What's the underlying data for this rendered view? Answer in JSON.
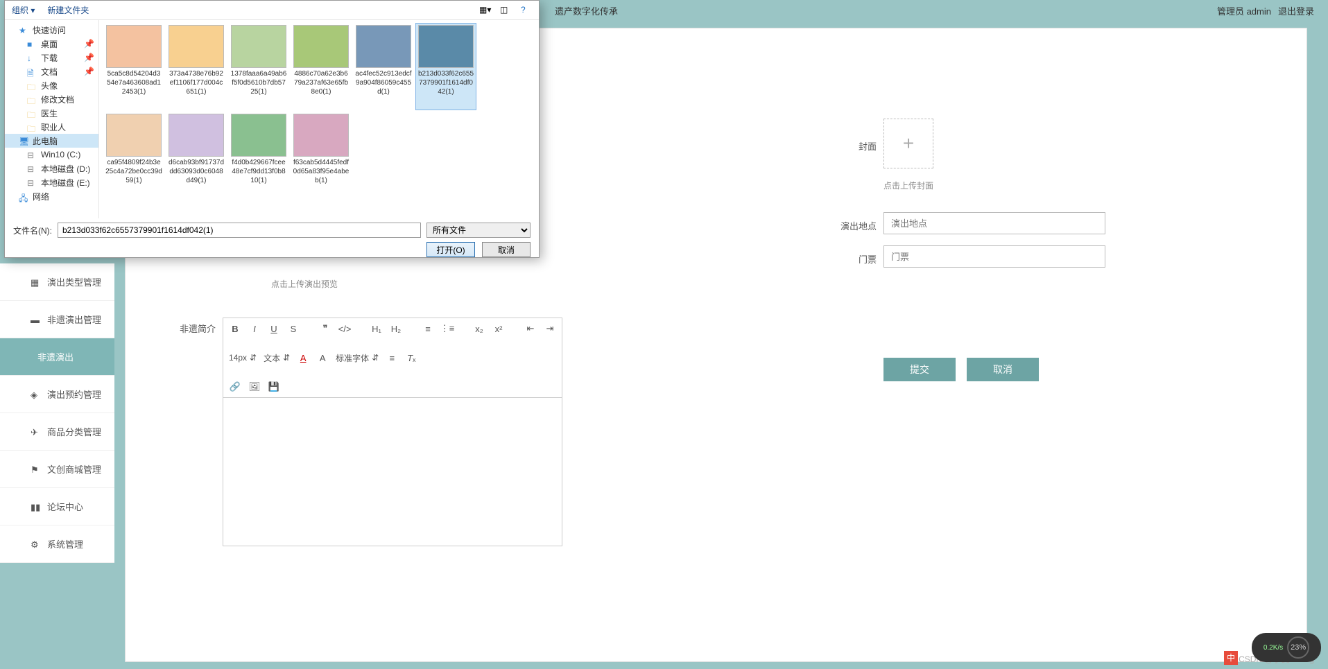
{
  "header": {
    "title": "遗产数字化传承",
    "admin_label": "管理员 admin",
    "logout": "退出登录"
  },
  "sidebar": {
    "items": [
      {
        "label": "演出类型管理"
      },
      {
        "label": "非遗演出管理"
      },
      {
        "label": "非遗演出"
      },
      {
        "label": "演出预约管理"
      },
      {
        "label": "商品分类管理"
      },
      {
        "label": "文创商城管理"
      },
      {
        "label": "论坛中心"
      },
      {
        "label": "系统管理"
      }
    ],
    "active_index": 2
  },
  "form": {
    "preview_hint": "点击上传演出预览",
    "intro_label": "非遗简介",
    "cover_label": "封面",
    "cover_hint": "点击上传封面",
    "venue_label": "演出地点",
    "venue_placeholder": "演出地点",
    "ticket_label": "门票",
    "ticket_placeholder": "门票",
    "submit": "提交",
    "cancel": "取消"
  },
  "editor": {
    "font_size": "14px",
    "font_type": "文本",
    "font_family": "标准字体"
  },
  "dialog": {
    "organize": "组织 ▾",
    "new_folder": "新建文件夹",
    "nav": {
      "quick_access": "快速访问",
      "desktop": "桌面",
      "downloads": "下载",
      "documents": "文档",
      "avatar": "头像",
      "edit_docs": "修改文档",
      "doctor": "医生",
      "professional": "职业人",
      "this_pc": "此电脑",
      "win10": "Win10 (C:)",
      "local_d": "本地磁盘 (D:)",
      "local_e": "本地磁盘 (E:)",
      "network": "网络"
    },
    "files": [
      {
        "name": "5ca5c8d54204d354e7a463608ad12453(1)"
      },
      {
        "name": "373a4738e76b92ef1106f177d004c651(1)"
      },
      {
        "name": "1378faaa6a49ab6f5f0d5610b7db5725(1)"
      },
      {
        "name": "4886c70a62e3b679a237af63e65fb8e0(1)"
      },
      {
        "name": "ac4fec52c913edcf9a904f86059c455d(1)"
      },
      {
        "name": "b213d033f62c6557379901f1614df042(1)"
      },
      {
        "name": "ca95f4809f24b3e25c4a72be0cc39d59(1)"
      },
      {
        "name": "d6cab93bf91737ddd63093d0c6048d49(1)"
      },
      {
        "name": "f4d0b429667fcee48e7cf9dd13f0b810(1)"
      },
      {
        "name": "f63cab5d4445fedf0d65a83f95e4abeb(1)"
      }
    ],
    "selected_index": 5,
    "filename_label": "文件名(N):",
    "filename_value": "b213d033f62c6557379901f1614df042(1)",
    "filter": "所有文件",
    "open": "打开(O)",
    "cancel": "取消"
  },
  "footer": {
    "watermark": "CSDN @小麦coding",
    "net_speed": "0.2K/s",
    "widget_pct": "23%",
    "ime": "中"
  }
}
